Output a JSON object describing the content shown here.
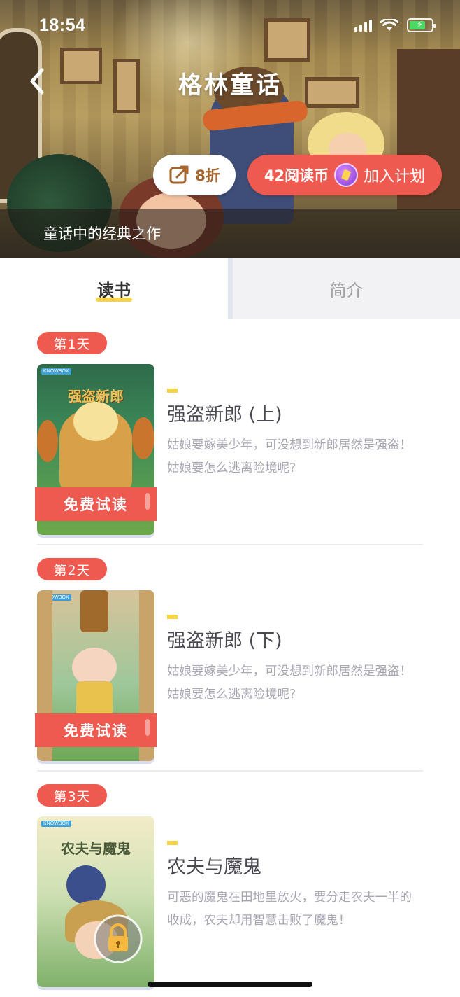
{
  "status_bar": {
    "time": "18:54"
  },
  "header": {
    "title": "格林童话",
    "subtitle": "童话中的经典之作",
    "discount_label": "8折",
    "price_label": "42阅读币",
    "join_label": "加入计划"
  },
  "tabs": [
    {
      "label": "读书",
      "active": true
    },
    {
      "label": "简介",
      "active": false
    }
  ],
  "chapters": [
    {
      "day": "第1天",
      "title": "强盗新郎 (上)",
      "cover_title": "强盗新郎",
      "description": "姑娘要嫁美少年，可没想到新郎居然是强盗！姑娘要怎么逃离险境呢?",
      "badge": "免费试读",
      "locked": false
    },
    {
      "day": "第2天",
      "title": "强盗新郎 (下)",
      "cover_title": "",
      "description": "姑娘要嫁美少年，可没想到新郎居然是强盗！姑娘要怎么逃离险境呢?",
      "badge": "免费试读",
      "locked": false
    },
    {
      "day": "第3天",
      "title": "农夫与魔鬼",
      "cover_title": "农夫与魔鬼",
      "description": "可恶的魔鬼在田地里放火，要分走农夫一半的收成，农夫却用智慧击败了魔鬼！",
      "badge": "",
      "locked": true
    }
  ],
  "cover_brand": "KNOWBOX",
  "colors": {
    "accent_red": "#ee5a50",
    "accent_yellow": "#f7d347",
    "discount_text": "#a5652d",
    "coin_purple": "#9b4fe0"
  },
  "icons": [
    "back-arrow-icon",
    "edit-discount-icon",
    "coin-icon",
    "lock-icon",
    "signal-icon",
    "wifi-icon",
    "battery-icon"
  ]
}
